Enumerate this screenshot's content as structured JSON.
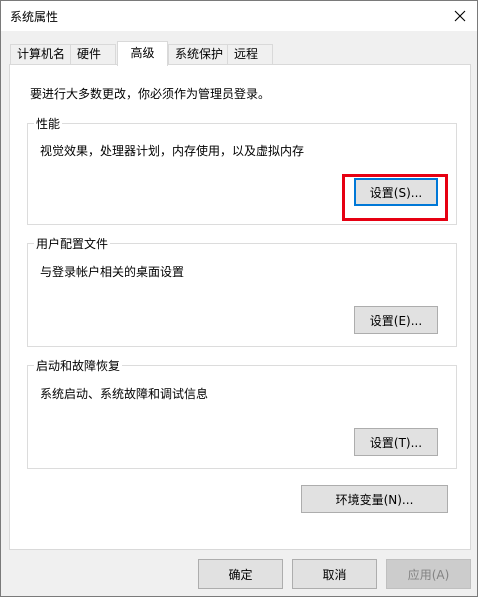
{
  "window": {
    "title": "系统属性"
  },
  "tabs": [
    {
      "label": "计算机名"
    },
    {
      "label": "硬件"
    },
    {
      "label": "高级",
      "active": true
    },
    {
      "label": "系统保护"
    },
    {
      "label": "远程"
    }
  ],
  "advanced": {
    "intro": "要进行大多数更改，你必须作为管理员登录。",
    "performance": {
      "title": "性能",
      "description": "视觉效果，处理器计划，内存使用，以及虚拟内存",
      "button": "设置(S)..."
    },
    "user_profiles": {
      "title": "用户配置文件",
      "description": "与登录帐户相关的桌面设置",
      "button": "设置(E)..."
    },
    "startup_recovery": {
      "title": "启动和故障恢复",
      "description": "系统启动、系统故障和调试信息",
      "button": "设置(T)..."
    },
    "env_button": "环境变量(N)..."
  },
  "footer": {
    "ok": "确定",
    "cancel": "取消",
    "apply": "应用(A)"
  },
  "colors": {
    "highlight": "#e60012",
    "focus": "#0078d7"
  }
}
